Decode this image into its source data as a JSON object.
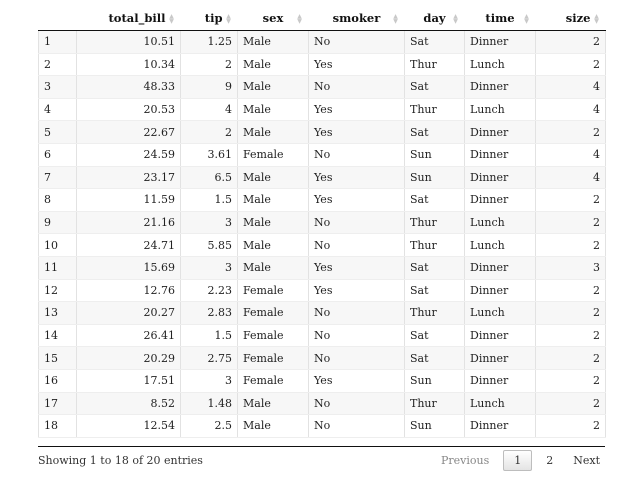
{
  "columns": [
    "",
    "total_bill",
    "tip",
    "sex",
    "smoker",
    "day",
    "time",
    "size"
  ],
  "rows": [
    [
      "1",
      "10.51",
      "1.25",
      "Male",
      "No",
      "Sat",
      "Dinner",
      "2"
    ],
    [
      "2",
      "10.34",
      "2",
      "Male",
      "Yes",
      "Thur",
      "Lunch",
      "2"
    ],
    [
      "3",
      "48.33",
      "9",
      "Male",
      "No",
      "Sat",
      "Dinner",
      "4"
    ],
    [
      "4",
      "20.53",
      "4",
      "Male",
      "Yes",
      "Thur",
      "Lunch",
      "4"
    ],
    [
      "5",
      "22.67",
      "2",
      "Male",
      "Yes",
      "Sat",
      "Dinner",
      "2"
    ],
    [
      "6",
      "24.59",
      "3.61",
      "Female",
      "No",
      "Sun",
      "Dinner",
      "4"
    ],
    [
      "7",
      "23.17",
      "6.5",
      "Male",
      "Yes",
      "Sun",
      "Dinner",
      "4"
    ],
    [
      "8",
      "11.59",
      "1.5",
      "Male",
      "Yes",
      "Sat",
      "Dinner",
      "2"
    ],
    [
      "9",
      "21.16",
      "3",
      "Male",
      "No",
      "Thur",
      "Lunch",
      "2"
    ],
    [
      "10",
      "24.71",
      "5.85",
      "Male",
      "No",
      "Thur",
      "Lunch",
      "2"
    ],
    [
      "11",
      "15.69",
      "3",
      "Male",
      "Yes",
      "Sat",
      "Dinner",
      "3"
    ],
    [
      "12",
      "12.76",
      "2.23",
      "Female",
      "Yes",
      "Sat",
      "Dinner",
      "2"
    ],
    [
      "13",
      "20.27",
      "2.83",
      "Female",
      "No",
      "Thur",
      "Lunch",
      "2"
    ],
    [
      "14",
      "26.41",
      "1.5",
      "Female",
      "No",
      "Sat",
      "Dinner",
      "2"
    ],
    [
      "15",
      "20.29",
      "2.75",
      "Female",
      "No",
      "Sat",
      "Dinner",
      "2"
    ],
    [
      "16",
      "17.51",
      "3",
      "Female",
      "Yes",
      "Sun",
      "Dinner",
      "2"
    ],
    [
      "17",
      "8.52",
      "1.48",
      "Male",
      "No",
      "Thur",
      "Lunch",
      "2"
    ],
    [
      "18",
      "12.54",
      "2.5",
      "Male",
      "No",
      "Sun",
      "Dinner",
      "2"
    ]
  ],
  "footer": {
    "info": "Showing 1 to 18 of 20 entries",
    "previous": "Previous",
    "pages": [
      "1",
      "2"
    ],
    "next": "Next"
  }
}
